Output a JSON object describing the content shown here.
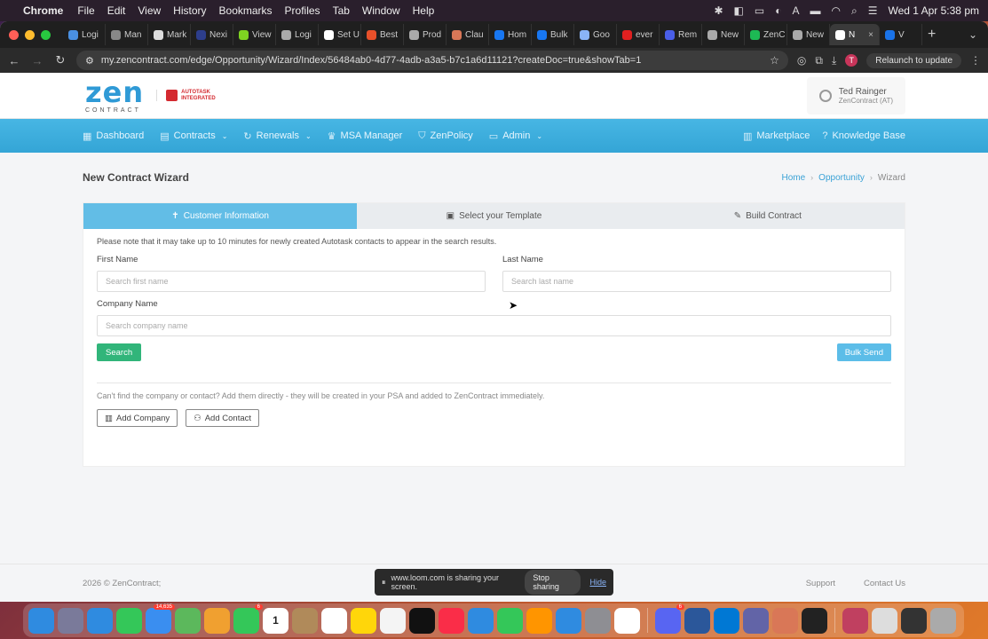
{
  "menubar": {
    "app": "Chrome",
    "items": [
      "File",
      "Edit",
      "View",
      "History",
      "Bookmarks",
      "Profiles",
      "Tab",
      "Window",
      "Help"
    ],
    "datetime": "Wed 1 Apr  5:38 pm"
  },
  "tabs": [
    {
      "label": "Logi",
      "color": "#4a90e2"
    },
    {
      "label": "Man",
      "color": "#888888"
    },
    {
      "label": "Mark",
      "color": "#dddddd"
    },
    {
      "label": "Nexi",
      "color": "#2d3e8c"
    },
    {
      "label": "View",
      "color": "#7ed321"
    },
    {
      "label": "Logi",
      "color": "#aaaaaa"
    },
    {
      "label": "Set U",
      "color": "#ffffff"
    },
    {
      "label": "Best",
      "color": "#e8502a"
    },
    {
      "label": "Prod",
      "color": "#aaaaaa"
    },
    {
      "label": "Clau",
      "color": "#d97757"
    },
    {
      "label": "Hom",
      "color": "#1877f2"
    },
    {
      "label": "Bulk",
      "color": "#1877f2"
    },
    {
      "label": "Goo",
      "color": "#8ab4f8"
    },
    {
      "label": "ever",
      "color": "#e02020"
    },
    {
      "label": "Rem",
      "color": "#4a5ee8"
    },
    {
      "label": "New",
      "color": "#aaaaaa"
    },
    {
      "label": "ZenC",
      "color": "#1db954"
    },
    {
      "label": "New",
      "color": "#aaaaaa"
    },
    {
      "label": "N",
      "color": "#ffffff",
      "active": true
    },
    {
      "label": "V",
      "color": "#1a73e8"
    }
  ],
  "toolbar": {
    "url": "my.zencontract.com/edge/Opportunity/Wizard/Index/56484ab0-4d77-4adb-a3a5-b7c1a6d11121?createDoc=true&showTab=1",
    "relaunch": "Relaunch to update",
    "profile_initial": "T"
  },
  "header": {
    "logo_main": "zen",
    "logo_sub": "CONTRACT",
    "partner_line1": "AUTOTASK",
    "partner_line2": "INTEGRATED",
    "user_name": "Ted Rainger",
    "user_org": "ZenContract (AT)"
  },
  "nav": {
    "left": [
      {
        "label": "Dashboard",
        "icon": "grid-icon",
        "glyph": "▦",
        "caret": false
      },
      {
        "label": "Contracts",
        "icon": "document-icon",
        "glyph": "▤",
        "caret": true
      },
      {
        "label": "Renewals",
        "icon": "refresh-icon",
        "glyph": "↻",
        "caret": true
      },
      {
        "label": "MSA Manager",
        "icon": "crown-icon",
        "glyph": "♛",
        "caret": false
      },
      {
        "label": "ZenPolicy",
        "icon": "shield-icon",
        "glyph": "⛉",
        "caret": false
      },
      {
        "label": "Admin",
        "icon": "chat-icon",
        "glyph": "▭",
        "caret": true
      }
    ],
    "right": [
      {
        "label": "Marketplace",
        "icon": "store-icon",
        "glyph": "▥"
      },
      {
        "label": "Knowledge Base",
        "icon": "help-icon",
        "glyph": "?"
      }
    ]
  },
  "page": {
    "title": "New Contract Wizard",
    "breadcrumb": [
      "Home",
      "Opportunity",
      "Wizard"
    ]
  },
  "wizard": {
    "steps": [
      {
        "label": "Customer Information",
        "icon": "pin-icon",
        "glyph": "✝",
        "active": true
      },
      {
        "label": "Select your Template",
        "icon": "template-icon",
        "glyph": "▣",
        "active": false
      },
      {
        "label": "Build Contract",
        "icon": "pencil-icon",
        "glyph": "✎",
        "active": false
      }
    ],
    "note": "Please note that it may take up to 10 minutes for newly created Autotask contacts to appear in the search results.",
    "first_name_label": "First Name",
    "first_name_placeholder": "Search first name",
    "last_name_label": "Last Name",
    "last_name_placeholder": "Search last name",
    "company_label": "Company Name",
    "company_placeholder": "Search company name",
    "search_btn": "Search",
    "bulk_btn": "Bulk Send",
    "hint": "Can't find the company or contact? Add them directly - they will be created in your PSA and added to ZenContract immediately.",
    "add_company": "Add Company",
    "add_contact": "Add Contact"
  },
  "footer": {
    "copyright": "2026 © ZenContract;",
    "links": [
      "Support",
      "Contact Us"
    ]
  },
  "share_banner": {
    "text": "www.loom.com is sharing your screen.",
    "stop": "Stop sharing",
    "hide": "Hide"
  },
  "dock": [
    {
      "name": "finder-icon",
      "color": "#2f8be0"
    },
    {
      "name": "launchpad-icon",
      "color": "#7a7a9a"
    },
    {
      "name": "safari-icon",
      "color": "#2f8be0"
    },
    {
      "name": "messages-icon",
      "color": "#34c759"
    },
    {
      "name": "mail-icon",
      "color": "#3a8ef0",
      "badge": "14,635"
    },
    {
      "name": "maps-icon",
      "color": "#5cb85c"
    },
    {
      "name": "photos-icon",
      "color": "#f0a030"
    },
    {
      "name": "facetime-icon",
      "color": "#34c759",
      "badge": "6"
    },
    {
      "name": "calendar-icon",
      "color": "#ffffff",
      "text": "1"
    },
    {
      "name": "contacts-icon",
      "color": "#b08a5a"
    },
    {
      "name": "reminders-icon",
      "color": "#ffffff"
    },
    {
      "name": "notes-icon",
      "color": "#ffd60a"
    },
    {
      "name": "freeform-icon",
      "color": "#f4f4f4"
    },
    {
      "name": "tv-icon",
      "color": "#111111"
    },
    {
      "name": "music-icon",
      "color": "#fa2d48"
    },
    {
      "name": "keynote-icon",
      "color": "#2f8be0"
    },
    {
      "name": "numbers-icon",
      "color": "#34c759"
    },
    {
      "name": "pages-icon",
      "color": "#ff9500"
    },
    {
      "name": "appstore-icon",
      "color": "#2f8be0"
    },
    {
      "name": "settings-icon",
      "color": "#8e8e93"
    },
    {
      "name": "chrome-icon",
      "color": "#ffffff"
    },
    {
      "name": "discord-icon",
      "color": "#5865f2",
      "badge": "6"
    },
    {
      "name": "word-icon",
      "color": "#2b579a"
    },
    {
      "name": "outlook-icon",
      "color": "#0078d4"
    },
    {
      "name": "teams-icon",
      "color": "#6264a7"
    },
    {
      "name": "claude-icon",
      "color": "#d97757"
    },
    {
      "name": "terminal-icon",
      "color": "#222222"
    },
    {
      "name": "help-dock-icon",
      "color": "#c04060"
    },
    {
      "name": "screenshot-icon",
      "color": "#dddddd"
    },
    {
      "name": "window-icon",
      "color": "#333333"
    },
    {
      "name": "trash-icon",
      "color": "#aaaaaa"
    }
  ]
}
